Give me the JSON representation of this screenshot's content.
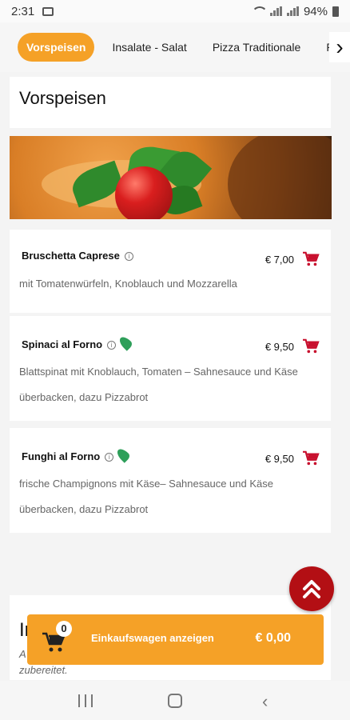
{
  "status": {
    "time": "2:31",
    "battery": "94%"
  },
  "tabs": [
    {
      "label": "Vorspeisen",
      "active": true
    },
    {
      "label": "Insalate - Salat",
      "active": false
    },
    {
      "label": "Pizza Traditionale",
      "active": false
    },
    {
      "label": "Pa",
      "active": false
    }
  ],
  "section": {
    "title": "Vorspeisen"
  },
  "items": [
    {
      "name": "Bruschetta Caprese",
      "vegetarian": false,
      "price": "€ 7,00",
      "desc": "mit Tomatenwürfeln, Knoblauch und Mozzarella"
    },
    {
      "name": "Spinaci al Forno",
      "vegetarian": true,
      "price": "€ 9,50",
      "desc": "Blattspinat mit Knoblauch, Tomaten – Sahnesauce und Käse überbacken, dazu Pizzabrot"
    },
    {
      "name": "Funghi al Forno",
      "vegetarian": true,
      "price": "€ 9,50",
      "desc": "frische Champignons mit Käse– Sahnesauce und Käse überbacken, dazu Pizzabrot"
    }
  ],
  "next_section": {
    "title_partial": "In",
    "line_partial": "A",
    "line2_partial": "zubereitet."
  },
  "cart": {
    "count": "0",
    "label": "Einkaufswagen anzeigen",
    "total": "€ 0,00"
  },
  "colors": {
    "accent": "#f5a127",
    "cart_icon": "#c8102e",
    "scroll_top": "#b30f14",
    "veg_leaf": "#2e9f5a"
  },
  "icons": {
    "info": "info-circle-icon",
    "veg": "leaf-icon",
    "add_to_cart": "shopping-cart-icon",
    "scroll_top": "double-chevron-up-icon"
  }
}
